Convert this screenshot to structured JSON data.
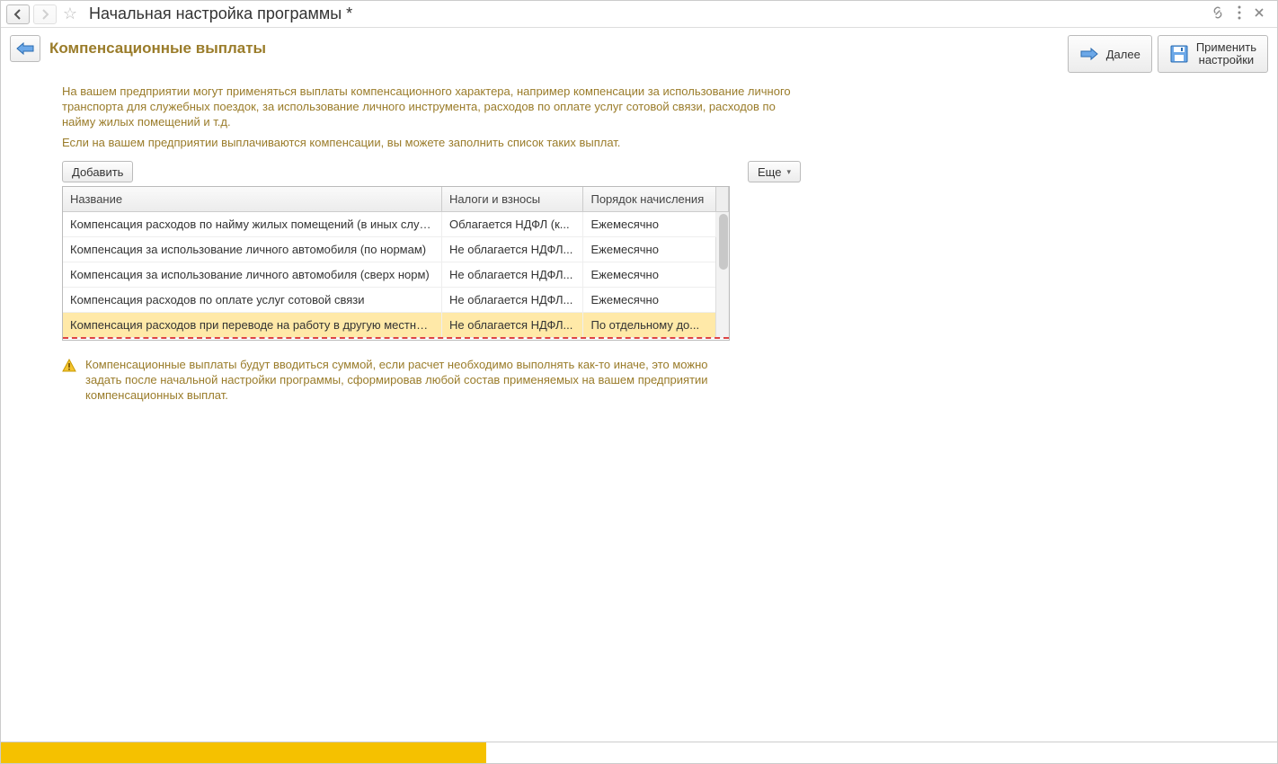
{
  "titleBar": {
    "title": "Начальная настройка программы *"
  },
  "toolbar": {
    "sectionTitle": "Компенсационные выплаты",
    "nextLabel": "Далее",
    "applyLabel1": "Применить",
    "applyLabel2": "настройки"
  },
  "description": {
    "p1": "На вашем предприятии могут применяться выплаты компенсационного характера, например компенсации за использование личного транспорта для служебных поездок, за использование личного инструмента, расходов по оплате услуг сотовой связи, расходов по найму жилых помещений и т.д.",
    "p2": "Если на вашем предприятии выплачиваются компенсации, вы можете заполнить список таких выплат."
  },
  "tableToolbar": {
    "addLabel": "Добавить",
    "moreLabel": "Еще"
  },
  "table": {
    "headers": {
      "name": "Название",
      "tax": "Налоги и взносы",
      "order": "Порядок начисления"
    },
    "rows": [
      {
        "name": "Компенсация расходов по найму жилых помещений (в иных случ...",
        "tax": "Облагается НДФЛ (к...",
        "order": "Ежемесячно"
      },
      {
        "name": "Компенсация за использование личного автомобиля (по нормам)",
        "tax": "Не облагается НДФЛ...",
        "order": "Ежемесячно"
      },
      {
        "name": "Компенсация за использование личного автомобиля (сверх норм)",
        "tax": "Не облагается НДФЛ...",
        "order": "Ежемесячно"
      },
      {
        "name": "Компенсация расходов по оплате услуг сотовой связи",
        "tax": "Не облагается НДФЛ...",
        "order": "Ежемесячно"
      },
      {
        "name": "Компенсация расходов при переводе на работу в другую местность",
        "tax": "Не облагается НДФЛ...",
        "order": "По отдельному до..."
      }
    ]
  },
  "info": {
    "text": "Компенсационные выплаты будут вводиться суммой, если расчет необходимо выполнять как-то иначе, это можно задать после начальной настройки программы, сформировав любой состав применяемых на вашем предприятии компенсационных выплат."
  }
}
